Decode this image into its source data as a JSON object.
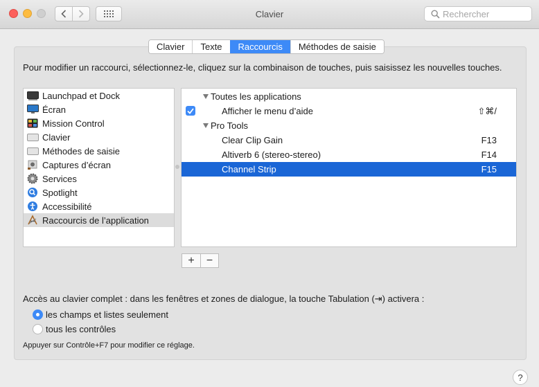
{
  "window": {
    "title": "Clavier"
  },
  "search": {
    "placeholder": "Rechercher"
  },
  "tabs": [
    {
      "label": "Clavier",
      "active": false
    },
    {
      "label": "Texte",
      "active": false
    },
    {
      "label": "Raccourcis",
      "active": true
    },
    {
      "label": "Méthodes de saisie",
      "active": false
    }
  ],
  "instructions": "Pour modifier un raccourci, sélectionnez-le, cliquez sur la combinaison de touches, puis saisissez les nouvelles touches.",
  "categories": [
    {
      "label": "Launchpad et Dock",
      "icon": "launchpad-icon"
    },
    {
      "label": "Écran",
      "icon": "display-icon"
    },
    {
      "label": "Mission Control",
      "icon": "mission-control-icon"
    },
    {
      "label": "Clavier",
      "icon": "keyboard-icon"
    },
    {
      "label": "Méthodes de saisie",
      "icon": "input-source-icon"
    },
    {
      "label": "Captures d’écran",
      "icon": "screenshot-icon"
    },
    {
      "label": "Services",
      "icon": "gear-icon"
    },
    {
      "label": "Spotlight",
      "icon": "spotlight-icon"
    },
    {
      "label": "Accessibilité",
      "icon": "accessibility-icon"
    },
    {
      "label": "Raccourcis de l’application",
      "icon": "app-shortcuts-icon"
    }
  ],
  "shortcuts": {
    "group_all": "Toutes les applications",
    "help_menu": {
      "label": "Afficher le menu d’aide",
      "key": "⇧⌘/",
      "checked": true
    },
    "group_protools": "Pro Tools",
    "entries": [
      {
        "label": "Clear Clip Gain",
        "key": "F13"
      },
      {
        "label": "Altiverb 6 (stereo-stereo)",
        "key": "F14"
      },
      {
        "label": "Channel Strip",
        "key": "F15"
      }
    ]
  },
  "buttons": {
    "add": "+",
    "remove": "−"
  },
  "access": {
    "label": "Accès au clavier complet : dans les fenêtres et zones de dialogue, la touche Tabulation (⇥) activera :",
    "options": [
      {
        "label": "les champs et listes seulement",
        "selected": true
      },
      {
        "label": "tous les contrôles",
        "selected": false
      }
    ],
    "hint": "Appuyer sur Contrôle+F7 pour modifier ce réglage."
  },
  "help": "?",
  "colors": {
    "accent": "#3d8af7",
    "selection": "#1a66d6"
  }
}
